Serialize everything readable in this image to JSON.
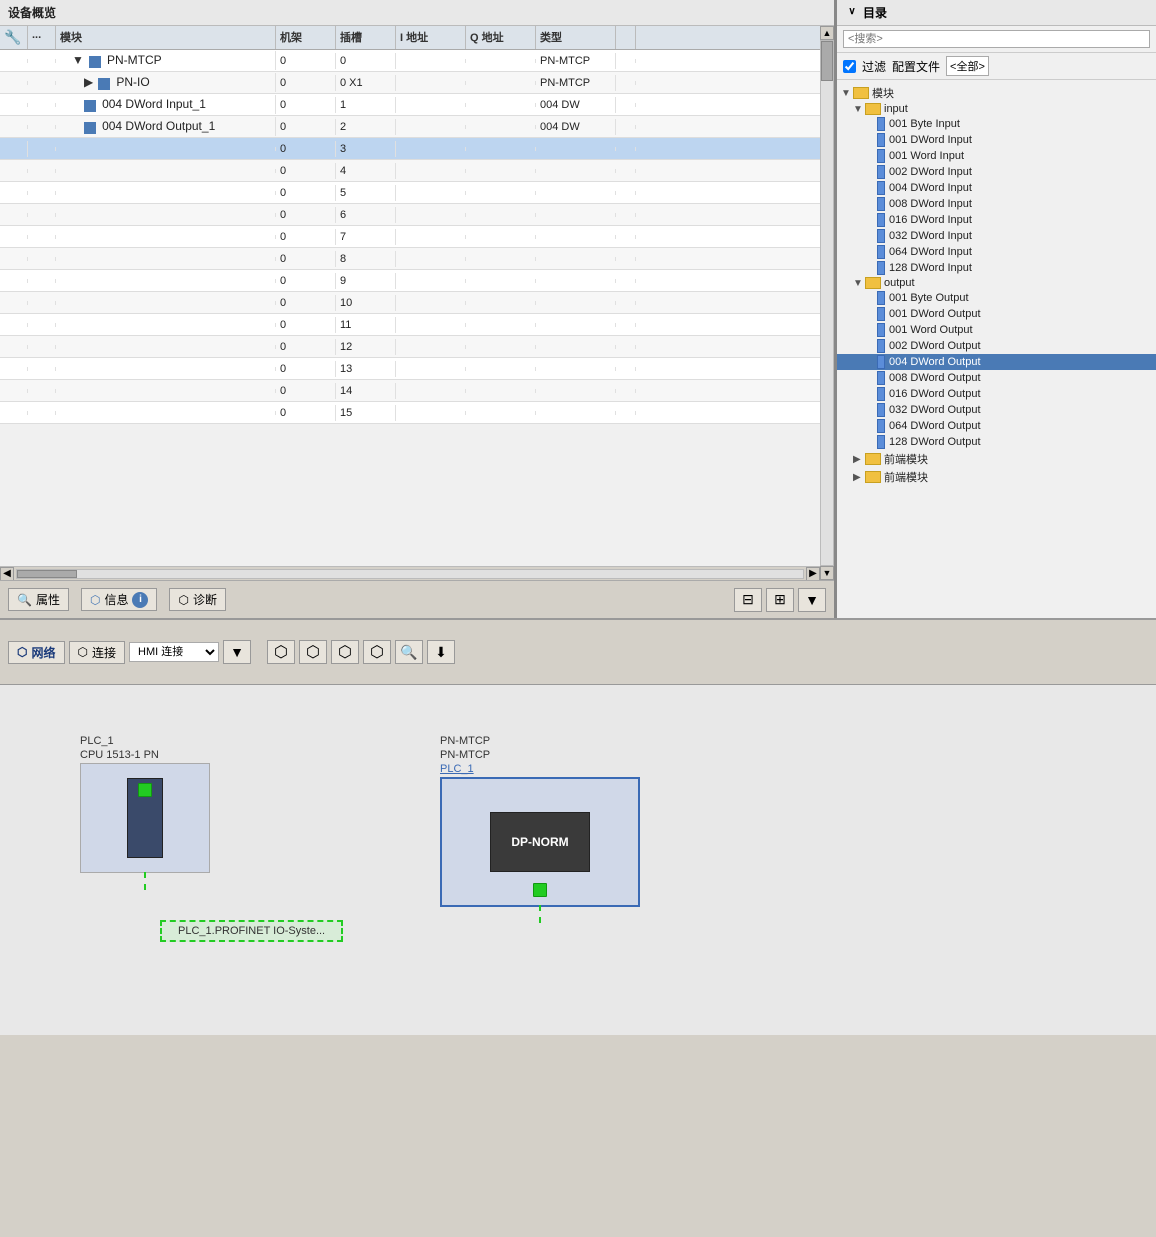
{
  "deviceOverview": {
    "title": "设备概览",
    "columns": [
      "",
      "",
      "模块",
      "机架",
      "插槽",
      "I 地址",
      "Q 地址",
      "类型"
    ],
    "rows": [
      {
        "indent": 1,
        "arrow": "▼",
        "name": "PN-MTCP",
        "rack": "0",
        "slot": "0",
        "iaddr": "",
        "qaddr": "",
        "type": "PN-MTCP",
        "selected": false,
        "alt": false
      },
      {
        "indent": 2,
        "arrow": "▶",
        "name": "PN-IO",
        "rack": "0",
        "slot": "0 X1",
        "iaddr": "",
        "qaddr": "",
        "type": "PN-MTCP",
        "selected": false,
        "alt": true
      },
      {
        "indent": 2,
        "arrow": "",
        "name": "004 DWord Input_1",
        "rack": "0",
        "slot": "1",
        "iaddr": "",
        "qaddr": "",
        "type": "004 DW",
        "selected": false,
        "alt": false
      },
      {
        "indent": 2,
        "arrow": "",
        "name": "004 DWord Output_1",
        "rack": "0",
        "slot": "2",
        "iaddr": "",
        "qaddr": "",
        "type": "004 DW",
        "selected": false,
        "alt": true
      },
      {
        "indent": 0,
        "arrow": "",
        "name": "",
        "rack": "0",
        "slot": "3",
        "iaddr": "",
        "qaddr": "",
        "type": "",
        "selected": true,
        "alt": false
      },
      {
        "indent": 0,
        "arrow": "",
        "name": "",
        "rack": "0",
        "slot": "4",
        "iaddr": "",
        "qaddr": "",
        "type": "",
        "selected": false,
        "alt": true
      },
      {
        "indent": 0,
        "arrow": "",
        "name": "",
        "rack": "0",
        "slot": "5",
        "iaddr": "",
        "qaddr": "",
        "type": "",
        "selected": false,
        "alt": false
      },
      {
        "indent": 0,
        "arrow": "",
        "name": "",
        "rack": "0",
        "slot": "6",
        "iaddr": "",
        "qaddr": "",
        "type": "",
        "selected": false,
        "alt": true
      },
      {
        "indent": 0,
        "arrow": "",
        "name": "",
        "rack": "0",
        "slot": "7",
        "iaddr": "",
        "qaddr": "",
        "type": "",
        "selected": false,
        "alt": false
      },
      {
        "indent": 0,
        "arrow": "",
        "name": "",
        "rack": "0",
        "slot": "8",
        "iaddr": "",
        "qaddr": "",
        "type": "",
        "selected": false,
        "alt": true
      },
      {
        "indent": 0,
        "arrow": "",
        "name": "",
        "rack": "0",
        "slot": "9",
        "iaddr": "",
        "qaddr": "",
        "type": "",
        "selected": false,
        "alt": false
      },
      {
        "indent": 0,
        "arrow": "",
        "name": "",
        "rack": "0",
        "slot": "10",
        "iaddr": "",
        "qaddr": "",
        "type": "",
        "selected": false,
        "alt": true
      },
      {
        "indent": 0,
        "arrow": "",
        "name": "",
        "rack": "0",
        "slot": "11",
        "iaddr": "",
        "qaddr": "",
        "type": "",
        "selected": false,
        "alt": false
      },
      {
        "indent": 0,
        "arrow": "",
        "name": "",
        "rack": "0",
        "slot": "12",
        "iaddr": "",
        "qaddr": "",
        "type": "",
        "selected": false,
        "alt": true
      },
      {
        "indent": 0,
        "arrow": "",
        "name": "",
        "rack": "0",
        "slot": "13",
        "iaddr": "",
        "qaddr": "",
        "type": "",
        "selected": false,
        "alt": false
      },
      {
        "indent": 0,
        "arrow": "",
        "name": "",
        "rack": "0",
        "slot": "14",
        "iaddr": "",
        "qaddr": "",
        "type": "",
        "selected": false,
        "alt": true
      },
      {
        "indent": 0,
        "arrow": "",
        "name": "",
        "rack": "0",
        "slot": "15",
        "iaddr": "",
        "qaddr": "",
        "type": "",
        "selected": false,
        "alt": false
      }
    ]
  },
  "toolbar": {
    "properties_label": "属性",
    "info_label": "信息",
    "diagnostics_label": "诊断"
  },
  "catalog": {
    "title": "目录",
    "search_placeholder": "<搜索>",
    "filter_label": "过滤",
    "config_label": "配置文件",
    "config_value": "<全部>",
    "collapse_label": "∨",
    "sections": [
      {
        "label": "模块",
        "indent": 0,
        "expanded": true,
        "children": [
          {
            "label": "input",
            "indent": 1,
            "expanded": true,
            "isFolder": true,
            "children": [
              {
                "label": "001 Byte Input",
                "indent": 2,
                "selected": false
              },
              {
                "label": "001 DWord Input",
                "indent": 2,
                "selected": false
              },
              {
                "label": "001 Word Input",
                "indent": 2,
                "selected": false
              },
              {
                "label": "002 DWord Input",
                "indent": 2,
                "selected": false
              },
              {
                "label": "004 DWord Input",
                "indent": 2,
                "selected": false
              },
              {
                "label": "008 DWord Input",
                "indent": 2,
                "selected": false
              },
              {
                "label": "016 DWord Input",
                "indent": 2,
                "selected": false
              },
              {
                "label": "032 DWord Input",
                "indent": 2,
                "selected": false
              },
              {
                "label": "064 DWord Input",
                "indent": 2,
                "selected": false
              },
              {
                "label": "128 DWord Input",
                "indent": 2,
                "selected": false
              }
            ]
          },
          {
            "label": "output",
            "indent": 1,
            "expanded": true,
            "isFolder": true,
            "children": [
              {
                "label": "001 Byte Output",
                "indent": 2,
                "selected": false
              },
              {
                "label": "001 DWord Output",
                "indent": 2,
                "selected": false
              },
              {
                "label": "001 Word Output",
                "indent": 2,
                "selected": false
              },
              {
                "label": "002 DWord Output",
                "indent": 2,
                "selected": false
              },
              {
                "label": "004 DWord Output",
                "indent": 2,
                "selected": true
              },
              {
                "label": "008 DWord Output",
                "indent": 2,
                "selected": false
              },
              {
                "label": "016 DWord Output",
                "indent": 2,
                "selected": false
              },
              {
                "label": "032 DWord Output",
                "indent": 2,
                "selected": false
              },
              {
                "label": "064 DWord Output",
                "indent": 2,
                "selected": false
              },
              {
                "label": "128 DWord Output",
                "indent": 2,
                "selected": false
              }
            ]
          },
          {
            "label": "前端模块",
            "indent": 1,
            "expanded": false,
            "isFolder": true,
            "children": []
          }
        ]
      }
    ]
  },
  "network": {
    "network_label": "网络",
    "connection_label": "连接",
    "hmi_label": "HMI 连接"
  },
  "diagram": {
    "plc1_name": "PLC_1",
    "plc1_type": "CPU 1513-1 PN",
    "pn_name": "PN-MTCP",
    "pn_type": "PN-MTCP",
    "pn_link": "PLC_1",
    "dp_label": "DP-NORM",
    "network_line": "PLC_1.PROFINET IO-Syste..."
  }
}
